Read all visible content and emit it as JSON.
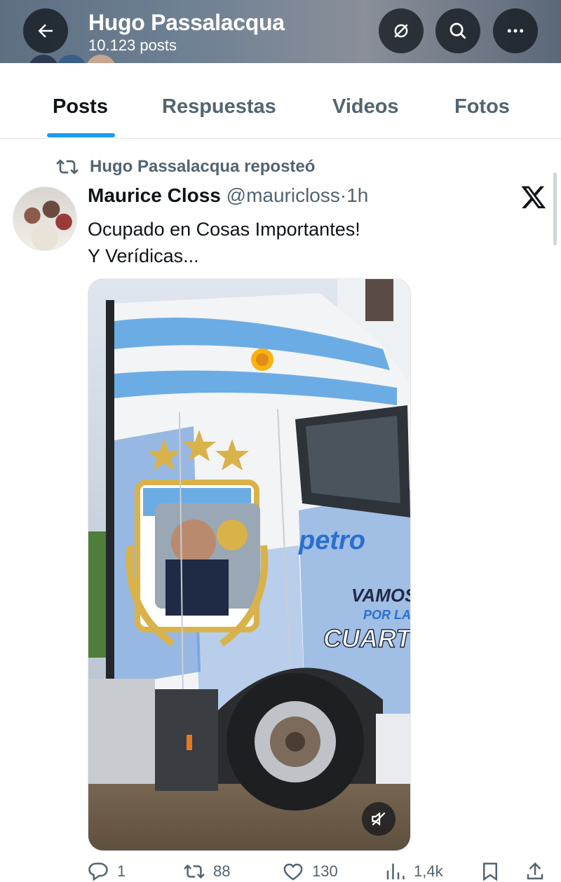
{
  "header": {
    "name": "Hugo Passalacqua",
    "post_count": "10.123 posts"
  },
  "tabs": [
    {
      "label": "Posts",
      "active": true
    },
    {
      "label": "Respuestas",
      "active": false
    },
    {
      "label": "Videos",
      "active": false
    },
    {
      "label": "Fotos",
      "active": false
    }
  ],
  "post": {
    "repost_label": "Hugo Passalacqua reposteó",
    "author_name": "Maurice Closs",
    "author_handle": "@mauricloss",
    "separator": "·",
    "time": "1h",
    "text_line1": "Ocupado en Cosas Importantes!",
    "text_line2": "Y Verídicas...",
    "media_text": {
      "brand": "petro",
      "line1": "VAMOS",
      "line2": "POR LA",
      "line3": "CUART"
    },
    "actions": {
      "replies": "1",
      "reposts": "88",
      "likes": "130",
      "views": "1,4k"
    }
  },
  "colors": {
    "accent": "#1d9bf0",
    "text_primary": "#0f1419",
    "text_secondary": "#536471",
    "flag_blue": "#6cace4",
    "sun_gold": "#f6b40e"
  },
  "icons": [
    "back-arrow-icon",
    "mute-notifications-icon",
    "search-icon",
    "more-icon",
    "repost-icon",
    "x-logo-icon",
    "video-muted-icon",
    "reply-icon",
    "like-icon",
    "views-icon",
    "bookmark-icon",
    "share-icon"
  ]
}
